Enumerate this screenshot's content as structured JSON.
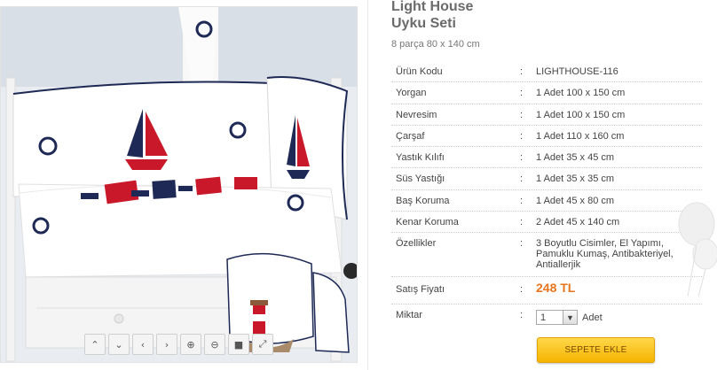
{
  "product": {
    "title_line1": "Light House",
    "title_line2": "Uyku Seti",
    "subtitle": "8 parça 80 x 140 cm"
  },
  "specs": [
    {
      "label": "Ürün Kodu",
      "sep": ":",
      "value": "LIGHTHOUSE-116"
    },
    {
      "label": "Yorgan",
      "sep": ":",
      "value": "1 Adet 100 x 150 cm"
    },
    {
      "label": "Nevresim",
      "sep": ":",
      "value": "1 Adet 100 x 150 cm"
    },
    {
      "label": "Çarşaf",
      "sep": ":",
      "value": "1 Adet 110 x 160 cm"
    },
    {
      "label": "Yastık Kılıfı",
      "sep": ":",
      "value": "1 Adet 35 x 45 cm"
    },
    {
      "label": "Süs Yastığı",
      "sep": ":",
      "value": "1 Adet 35 x 35 cm"
    },
    {
      "label": "Baş Koruma",
      "sep": ":",
      "value": "1 Adet 45 x 80 cm"
    },
    {
      "label": "Kenar Koruma",
      "sep": ":",
      "value": "2 Adet 45 x 140 cm"
    },
    {
      "label": "Özellikler",
      "sep": ":",
      "value": "3 Boyutlu Cisimler, El Yapımı, Pamuklu Kumaş, Antibakteriyel, Antiallerjik"
    }
  ],
  "price": {
    "label": "Satış Fiyatı",
    "sep": ":",
    "value": "248 TL"
  },
  "quantity": {
    "label": "Miktar",
    "sep": ":",
    "value": "1",
    "unit": "Adet"
  },
  "cart_button": "SEPETE EKLE",
  "gallery_controls": [
    {
      "name": "gallery-up-button",
      "glyph": "⌃"
    },
    {
      "name": "gallery-down-button",
      "glyph": "⌄"
    },
    {
      "name": "gallery-prev-button",
      "glyph": "‹"
    },
    {
      "name": "gallery-next-button",
      "glyph": "›"
    },
    {
      "name": "zoom-in-button",
      "glyph": "⊕"
    },
    {
      "name": "zoom-out-button",
      "glyph": "⊖"
    },
    {
      "name": "reset-button",
      "glyph": "■"
    },
    {
      "name": "fullscreen-button",
      "glyph": "⤢"
    }
  ],
  "colors": {
    "price": "#e8741e",
    "cart_button": "#f5b400",
    "navy": "#1e2a55",
    "red": "#c8182a"
  }
}
